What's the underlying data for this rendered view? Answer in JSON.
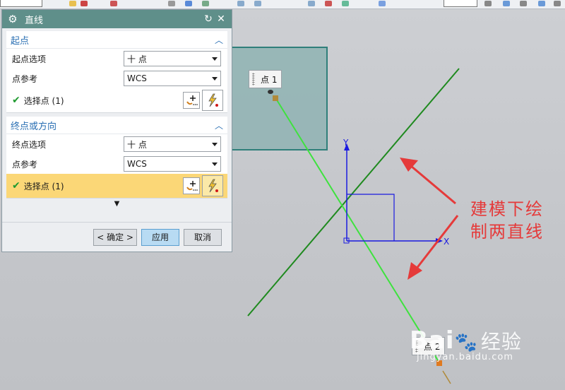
{
  "dialog": {
    "title": "直线",
    "icons": {
      "gear": "gear-icon",
      "reset": "reset-icon",
      "close": "close-icon"
    },
    "start_group": {
      "header": "起点",
      "option_label": "起点选项",
      "option_value": "十 点",
      "ref_label": "点参考",
      "ref_value": "WCS",
      "select_label": "选择点 (1)"
    },
    "end_group": {
      "header": "终点或方向",
      "option_label": "终点选项",
      "option_value": "十 点",
      "ref_label": "点参考",
      "ref_value": "WCS",
      "select_label": "选择点 (1)"
    },
    "more_glyph": "▼",
    "buttons": {
      "ok": "< 确定 >",
      "apply": "应用",
      "cancel": "取消"
    }
  },
  "viewport": {
    "point1_label": "点 1",
    "point2_label": "点 2",
    "axis_x": "X",
    "axis_y": "Y",
    "annotation_line1": "建模下绘",
    "annotation_line2": "制两直线",
    "colors": {
      "line_dark": "#1f8a1f",
      "line_bright": "#3ee23e",
      "arrow": "#e53a3a",
      "wcs": "#1a1ae0",
      "plane": "#8fb3b3"
    }
  },
  "watermark": {
    "brand": "Bai",
    "brand_suffix": "经验",
    "url": "jingyan.baidu.com"
  }
}
